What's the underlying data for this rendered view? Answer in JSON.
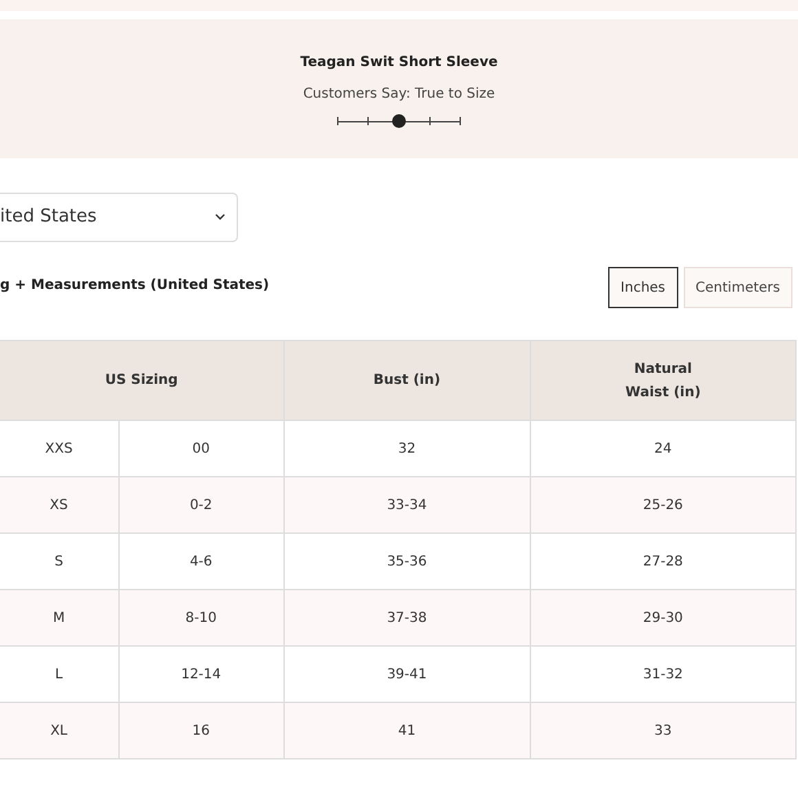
{
  "product": {
    "title": "Teagan Swit Short Sleeve",
    "fit_label": "Customers Say: True to Size",
    "fit_scale": {
      "level": 0.5
    }
  },
  "country_select": {
    "value": "ited States"
  },
  "section_title": "g + Measurements (United States)",
  "unit_buttons": [
    {
      "label": "Inches",
      "selected": true
    },
    {
      "label": "Centimeters",
      "selected": false
    }
  ],
  "table": {
    "columns": [
      {
        "label": "US Sizing",
        "colspan": 2
      },
      {
        "label": "Bust (in)"
      },
      {
        "label": "Natural\nWaist (in)"
      }
    ],
    "rows": [
      {
        "cells": [
          "XXS",
          "00",
          "32",
          "24"
        ]
      },
      {
        "cells": [
          "XS",
          "0-2",
          "33-34",
          "25-26"
        ]
      },
      {
        "cells": [
          "S",
          "4-6",
          "35-36",
          "27-28"
        ]
      },
      {
        "cells": [
          "M",
          "8-10",
          "37-38",
          "29-30"
        ]
      },
      {
        "cells": [
          "L",
          "12-14",
          "39-41",
          "31-32"
        ]
      },
      {
        "cells": [
          "XL",
          "16",
          "41",
          "33"
        ]
      }
    ]
  }
}
